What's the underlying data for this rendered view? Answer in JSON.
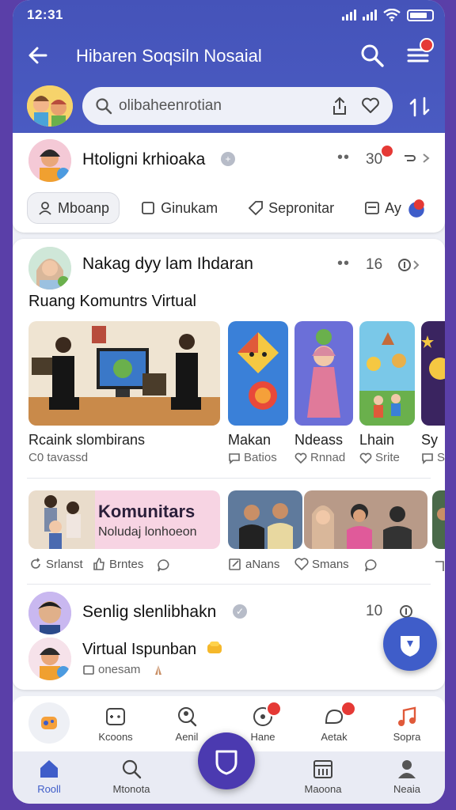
{
  "status": {
    "time": "12:31"
  },
  "appbar": {
    "title": "Hibaren Soqsiln Nosaial",
    "menu_badge": ""
  },
  "search": {
    "placeholder": "olibaheenrotian"
  },
  "post1": {
    "title": "Htoligni krhioaka",
    "count": "30",
    "count_badge": "",
    "chips": [
      {
        "label": "Mboanp"
      },
      {
        "label": "Ginukam"
      },
      {
        "label": "Sepronitar"
      },
      {
        "label": "Ay"
      }
    ]
  },
  "post2": {
    "title": "Nakag dyy lam Ihdaran",
    "count": "16",
    "subtitle": "Ruang Komuntrs Virtual",
    "thumbs": [
      {
        "caption": "Rcaink slombirans",
        "sub": "C0 tavassd"
      },
      {
        "caption": "Makan",
        "sub": "Batios"
      },
      {
        "caption": "Ndeass",
        "sub": "Rnnad"
      },
      {
        "caption": "Lhain",
        "sub": "Srite"
      },
      {
        "caption": "Sy",
        "sub": "S"
      }
    ],
    "komunitas": {
      "title": "Komunitars",
      "sub": "Noludaj lonhoeon"
    },
    "actions_left": [
      {
        "label": "Srlanst"
      },
      {
        "label": "Brntes"
      }
    ],
    "actions_right": [
      {
        "label": "aNans"
      },
      {
        "label": "Smans"
      }
    ]
  },
  "post3": {
    "title": "Senlig slenlibhakn",
    "count": "10",
    "line1": "Virtual Ispunban",
    "line2": "onesam"
  },
  "nav_top": [
    {
      "label": "Kcoons"
    },
    {
      "label": "Aenil"
    },
    {
      "label": "Hane",
      "badge": ""
    },
    {
      "label": "Aetak",
      "badge": ""
    },
    {
      "label": "Sopra"
    }
  ],
  "nav_bottom": [
    {
      "label": "Rooll"
    },
    {
      "label": "Mtonota"
    },
    {
      "label": "Maoona"
    },
    {
      "label": "Neaia"
    }
  ],
  "colors": {
    "primary": "#4553b9",
    "accent_red": "#e53935",
    "fab": "#3f5dc9",
    "center_fab": "#4b3ab0"
  }
}
